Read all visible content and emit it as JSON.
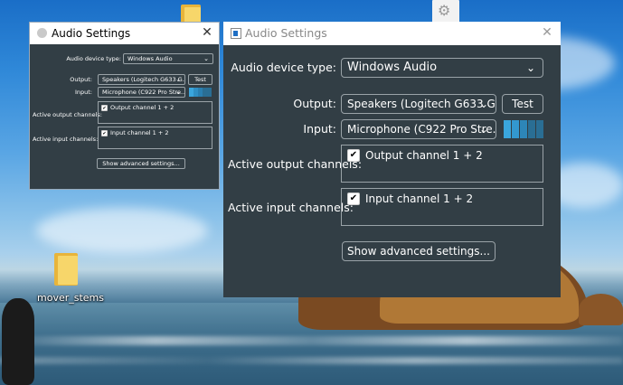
{
  "desktop": {
    "icons": [
      {
        "label": "mover_stems",
        "icon": "folder-icon"
      },
      {
        "label": "",
        "icon": "folder-icon"
      },
      {
        "label": "",
        "icon": "settings-file-icon"
      }
    ]
  },
  "small_window": {
    "title": "Audio Settings",
    "close": "✕",
    "device_type_label": "Audio device type:",
    "device_type_value": "Windows Audio",
    "output_label": "Output:",
    "output_value": "Speakers (Logitech G633 G...",
    "test_label": "Test",
    "input_label": "Input:",
    "input_value": "Microphone (C922 Pro Stre...",
    "active_output_label": "Active output channels:",
    "output_channel": "Output channel 1 + 2",
    "active_input_label": "Active input channels:",
    "input_channel": "Input channel 1 + 2",
    "advanced_label": "Show advanced settings...",
    "chevron": "⌄",
    "check": "✔"
  },
  "large_window": {
    "title": "Audio Settings",
    "close": "✕",
    "device_type_label": "Audio device type:",
    "device_type_value": "Windows Audio",
    "output_label": "Output:",
    "output_value": "Speakers (Logitech G633 G...",
    "test_label": "Test",
    "input_label": "Input:",
    "input_value": "Microphone (C922 Pro Stre...",
    "active_output_label": "Active output channels:",
    "output_channel": "Output channel 1 + 2",
    "active_input_label": "Active input channels:",
    "input_channel": "Input channel 1 + 2",
    "advanced_label": "Show advanced settings...",
    "chevron": "⌄",
    "check": "✔"
  },
  "colors": {
    "panel": "#323e45",
    "meter_active": "#3aa6dd",
    "meter_inactive": "#2a6e94",
    "border": "#9aa3a8"
  }
}
